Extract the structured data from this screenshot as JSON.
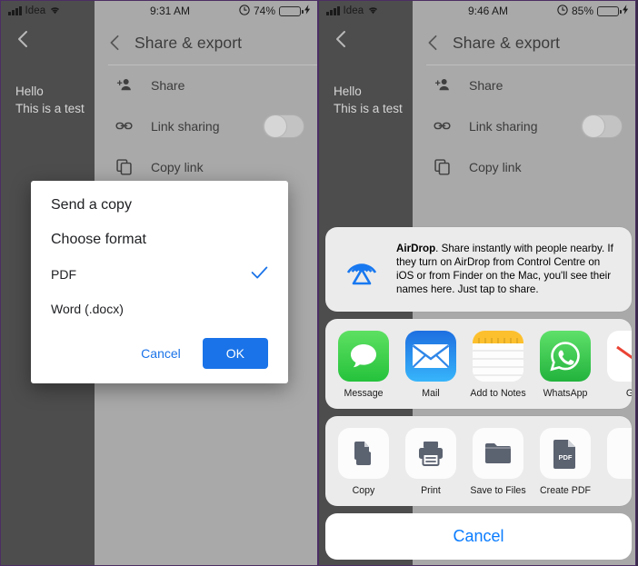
{
  "panels": [
    {
      "status": {
        "carrier": "Idea",
        "wifi_icon": "wifi-icon",
        "time": "9:31 AM",
        "alarm_icon": "alarm-icon",
        "battery_percent": "74%",
        "charging_icon": "bolt-icon"
      },
      "nav": {
        "back_icon": "chevron-left-icon",
        "title": "Share & export"
      },
      "doc": {
        "back_icon": "chevron-left-icon",
        "line1": "Hello",
        "line2": "This is a test"
      },
      "menu": [
        {
          "icon": "person-add-icon",
          "label": "Share",
          "control": "none"
        },
        {
          "icon": "link-icon",
          "label": "Link sharing",
          "control": "toggle",
          "toggle_on": false
        },
        {
          "icon": "copy-icon",
          "label": "Copy link",
          "control": "none"
        }
      ],
      "dialog": {
        "title": "Send a copy",
        "subtitle": "Choose format",
        "options": [
          {
            "label": "PDF",
            "selected": true,
            "check_icon": "check-icon"
          },
          {
            "label": "Word (.docx)",
            "selected": false,
            "check_icon": ""
          }
        ],
        "cancel_label": "Cancel",
        "ok_label": "OK",
        "accent_color": "#1a73e8"
      }
    },
    {
      "status": {
        "carrier": "Idea",
        "wifi_icon": "wifi-icon",
        "time": "9:46 AM",
        "alarm_icon": "alarm-icon",
        "battery_percent": "85%",
        "charging_icon": "bolt-icon"
      },
      "nav": {
        "back_icon": "chevron-left-icon",
        "title": "Share & export"
      },
      "doc": {
        "back_icon": "chevron-left-icon",
        "line1": "Hello",
        "line2": "This is a test"
      },
      "menu": [
        {
          "icon": "person-add-icon",
          "label": "Share",
          "control": "none"
        },
        {
          "icon": "link-icon",
          "label": "Link sharing",
          "control": "toggle",
          "toggle_on": false
        },
        {
          "icon": "copy-icon",
          "label": "Copy link",
          "control": "none"
        }
      ],
      "share_sheet": {
        "airdrop": {
          "icon": "airdrop-icon",
          "title": "AirDrop",
          "text": ". Share instantly with people nearby. If they turn on AirDrop from Control Centre on iOS or from Finder on the Mac, you'll see their names here. Just tap to share."
        },
        "apps": [
          {
            "icon": "messages-icon",
            "label": "Message",
            "color": "#43cc47"
          },
          {
            "icon": "mail-icon",
            "label": "Mail",
            "color": "#1d9bf7"
          },
          {
            "icon": "notes-icon",
            "label": "Add to Notes",
            "color": "#fdc02f"
          },
          {
            "icon": "whatsapp-icon",
            "label": "WhatsApp",
            "color": "#45c654"
          },
          {
            "icon": "gmail-icon",
            "label": "Go",
            "color": "#ffffff"
          }
        ],
        "actions": [
          {
            "icon": "copy-action-icon",
            "label": "Copy"
          },
          {
            "icon": "print-icon",
            "label": "Print"
          },
          {
            "icon": "folder-icon",
            "label": "Save to Files"
          },
          {
            "icon": "pdf-file-icon",
            "label": "Create PDF"
          },
          {
            "icon": "more-icon",
            "label": ""
          }
        ],
        "cancel_label": "Cancel",
        "accent_color": "#0a7cff"
      }
    }
  ]
}
